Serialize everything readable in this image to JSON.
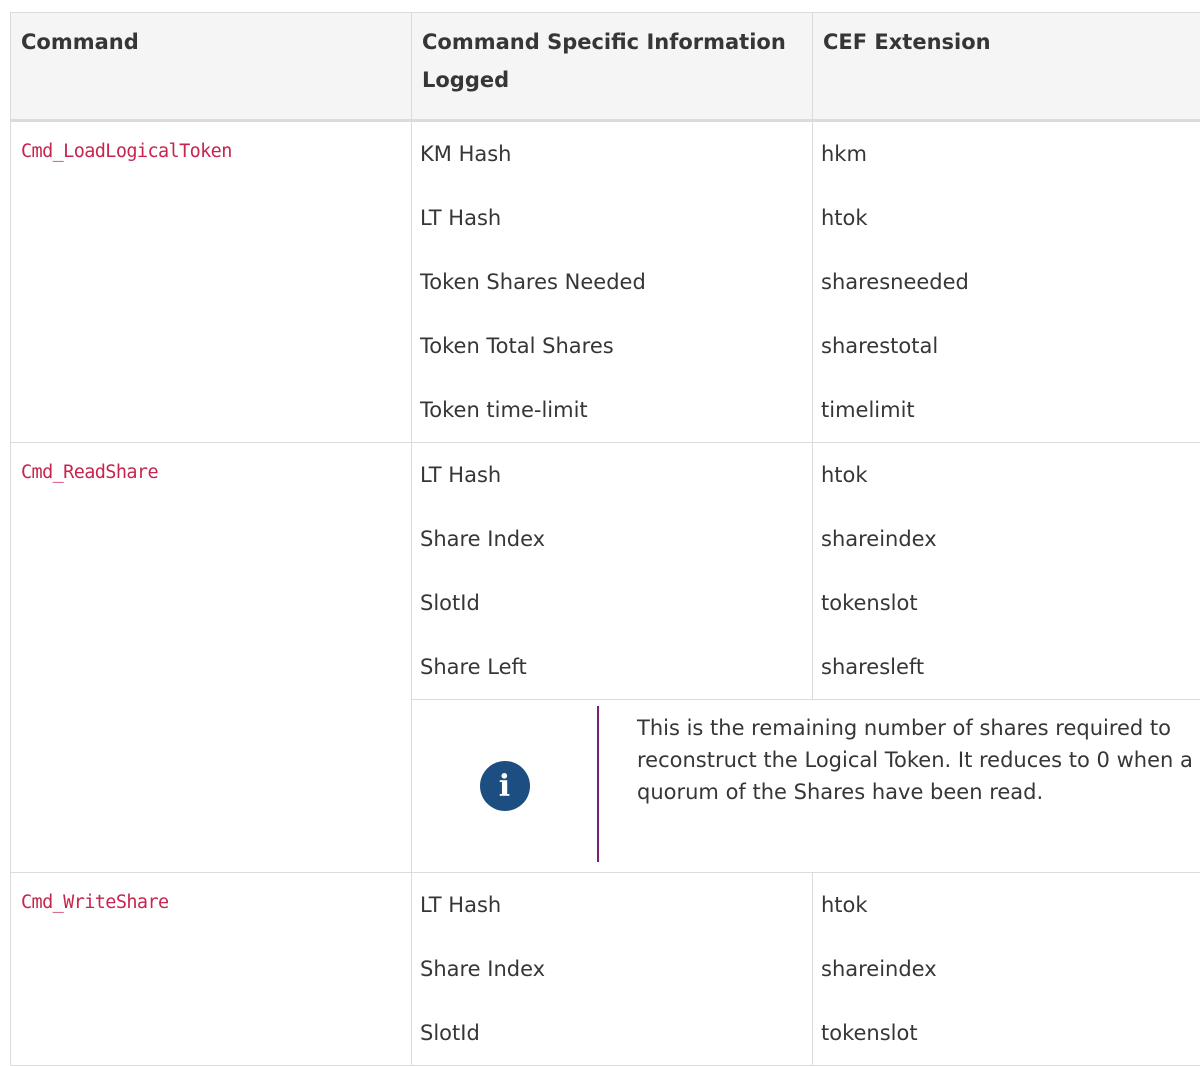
{
  "table": {
    "headers": [
      "Command",
      "Command Specific Information Logged",
      "CEF Extension"
    ],
    "groups": [
      {
        "command": "Cmd_LoadLogicalToken",
        "rows": [
          {
            "info": "KM Hash",
            "ext": "hkm"
          },
          {
            "info": "LT Hash",
            "ext": "htok"
          },
          {
            "info": "Token Shares Needed",
            "ext": "sharesneeded"
          },
          {
            "info": "Token Total Shares",
            "ext": "sharestotal"
          },
          {
            "info": "Token time-limit",
            "ext": "timelimit"
          }
        ]
      },
      {
        "command": "Cmd_ReadShare",
        "rows": [
          {
            "info": "LT Hash",
            "ext": "htok"
          },
          {
            "info": "Share Index",
            "ext": "shareindex"
          },
          {
            "info": "SlotId",
            "ext": "tokenslot"
          },
          {
            "info": "Share Left",
            "ext": "sharesleft"
          }
        ],
        "note": {
          "icon": "info-icon",
          "text": "This is the remaining number of shares required to reconstruct the Logical Token. It reduces to 0 when a quorum of the Shares have been read."
        }
      },
      {
        "command": "Cmd_WriteShare",
        "rows": [
          {
            "info": "LT Hash",
            "ext": "htok"
          },
          {
            "info": "Share Index",
            "ext": "shareindex"
          },
          {
            "info": "SlotId",
            "ext": "tokenslot"
          }
        ]
      }
    ]
  }
}
